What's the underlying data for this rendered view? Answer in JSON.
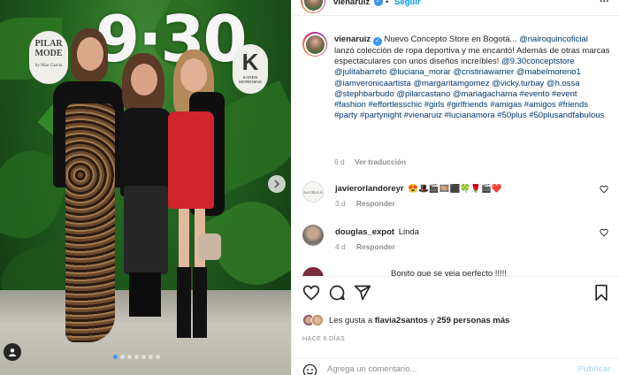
{
  "post": {
    "counter_text": "9·30",
    "left_logo_title": "PILAR MODE",
    "left_logo_sub": "by Pilar Garcia",
    "right_logo_letter": "K",
    "right_logo_sub": "KAREN MORENINS",
    "carousel_dots": 7,
    "carousel_active": 0
  },
  "header": {
    "username": "vienaruiz",
    "separator": "•",
    "follow_label": "Seguir",
    "more_label": "···"
  },
  "caption": {
    "username": "vienaruiz",
    "lead": "Nuevo Concepto Store en Bogotá...",
    "mention_1": "@nairoquincoficial",
    "body_1": "lanzó colección de ropa deportiva y me encantó! Además de otras marcas espectaculares con unos diseños increíbles!",
    "tags_1": "@9.30conceptstore @julitabarreto @luciana_morar @cristinawarner @mabelmoreno1 @iamveronicaartista @margaritamgomez @vicky.turbay @h.ossa @stephbarbudo @pilarcastano @mariagacharna #evento #event #fashion #effortlesschic #girls #girlfriends #amigas #amigos #friends #party #partynight #vienaruiz #lucianamora #50plus #50plusandfabulous",
    "age": "6 d",
    "see_translation": "Ver traducción"
  },
  "comments": [
    {
      "username": "javierorlandoreyr",
      "text": "😍🎩🎬🎞️⬛🍀🌹🎬❤️",
      "age": "3 d",
      "reply": "Responder",
      "avatar_text": "ILA ISLA A"
    },
    {
      "username": "douglas_expot",
      "text": "Linda",
      "age": "4 d",
      "reply": "Responder",
      "avatar_text": ""
    }
  ],
  "partial_comment": "Bonito que se veia perfecto !!!!!",
  "likes": {
    "prefix": "Les gusta a",
    "first": "flavia2santos",
    "conj": "y",
    "count_text": "259 personas más"
  },
  "time_ago": "HACE 6 DÍAS",
  "add_comment": {
    "placeholder": "Agrega un comentario...",
    "publish_label": "Publicar"
  },
  "colors": {
    "link": "#00376b",
    "accent": "#0095f6",
    "publish_disabled": "#b2dffc",
    "verified": "#3897f0"
  },
  "icons": [
    "heart-icon",
    "comment-icon",
    "share-icon",
    "bookmark-icon",
    "emoji-icon",
    "verified-icon",
    "tag-user-icon",
    "chevron-right-icon"
  ]
}
